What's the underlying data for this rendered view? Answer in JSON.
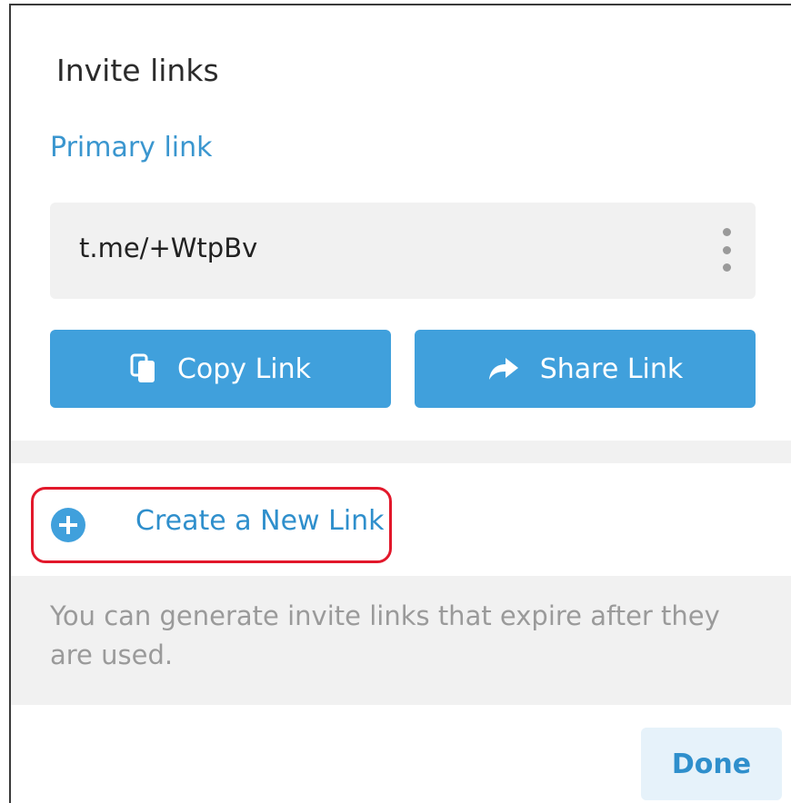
{
  "dialog": {
    "title": "Invite links"
  },
  "primary": {
    "section_title": "Primary link",
    "link": "t.me/+WtpBv"
  },
  "buttons": {
    "copy_label": "Copy Link",
    "share_label": "Share Link"
  },
  "create": {
    "label": "Create a New Link"
  },
  "hint": {
    "text": "You can generate invite links that expire after they are used."
  },
  "footer": {
    "done_label": "Done"
  },
  "colors": {
    "accent": "#40a0dc",
    "link_text": "#2f8fcc",
    "highlight": "#e2182b",
    "muted_bg": "#f1f1f1"
  },
  "icons": {
    "more": "more-vertical-icon",
    "copy": "copy-icon",
    "share": "share-arrow-icon",
    "add": "plus-circle-icon"
  }
}
